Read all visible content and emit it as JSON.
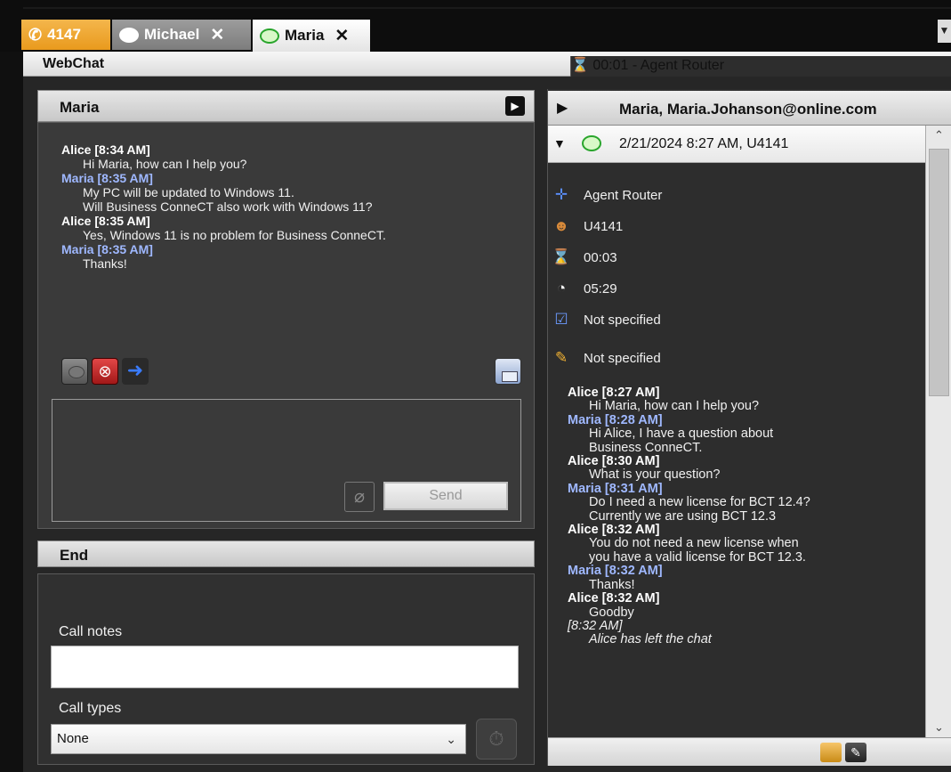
{
  "tabs": [
    {
      "label": "4147",
      "icon": "phone-icon",
      "color": "#e99a1d"
    },
    {
      "label": "Michael",
      "icon": "chat-bubble-icon"
    },
    {
      "label": "Maria",
      "icon": "chat-bubble-green-icon",
      "active": true
    }
  ],
  "status": {
    "title": "WebChat",
    "right": "⌛ 00:01  -  Agent Router"
  },
  "chat_panel": {
    "title": "Maria",
    "messages": [
      {
        "author": "Alice [8:34 AM]",
        "who": "agent",
        "lines": [
          "Hi Maria, how can I help you?"
        ]
      },
      {
        "author": "Maria [8:35 AM]",
        "who": "customer",
        "lines": [
          "My PC will be updated to Windows 11.",
          "Will Business ConneCT also work with Windows 11?"
        ]
      },
      {
        "author": "Alice [8:35 AM]",
        "who": "agent",
        "lines": [
          "Yes, Windows 11 is no problem for Business ConneCT."
        ]
      },
      {
        "author": "Maria [8:35 AM]",
        "who": "customer",
        "lines": [
          "Thanks!"
        ]
      }
    ],
    "send_label": "Send"
  },
  "end_panel": {
    "title": "End",
    "call_notes_label": "Call notes",
    "call_notes_value": "",
    "call_types_label": "Call types",
    "call_types_value": "None"
  },
  "info_panel": {
    "title": "Maria, Maria.Johanson@online.com",
    "session": "2/21/2024 8:27 AM, U4141",
    "rows": [
      {
        "icon": "move-icon",
        "value": "Agent Router"
      },
      {
        "icon": "user-icon",
        "value": "U4141"
      },
      {
        "icon": "hourglass-icon",
        "value": "00:03"
      },
      {
        "icon": "clock-icon",
        "value": "05:29"
      },
      {
        "icon": "checkbox-icon",
        "value": "Not specified"
      },
      {
        "icon": "pencil-icon",
        "value": "Not specified"
      }
    ],
    "history": [
      {
        "author": "Alice [8:27 AM]",
        "who": "agent",
        "lines": [
          "Hi Maria, how can I help you?"
        ]
      },
      {
        "author": "Maria [8:28 AM]",
        "who": "customer",
        "lines": [
          "Hi Alice, I have a question about",
          "Business ConneCT."
        ]
      },
      {
        "author": "Alice [8:30 AM]",
        "who": "agent",
        "lines": [
          "What is your question?"
        ]
      },
      {
        "author": "Maria [8:31 AM]",
        "who": "customer",
        "lines": [
          "Do I need a new license for BCT 12.4?",
          "Currently we are using BCT 12.3"
        ]
      },
      {
        "author": "Alice [8:32 AM]",
        "who": "agent",
        "lines": [
          "You do not need a new license when",
          "you have a valid license for BCT 12.3."
        ]
      },
      {
        "author": "Maria [8:32 AM]",
        "who": "customer",
        "lines": [
          "Thanks!"
        ]
      },
      {
        "author": "Alice [8:32 AM]",
        "who": "agent",
        "lines": [
          "Goodby"
        ]
      },
      {
        "author": "[8:32 AM]",
        "who": "system",
        "lines": [
          "Alice has left the chat"
        ]
      }
    ]
  }
}
